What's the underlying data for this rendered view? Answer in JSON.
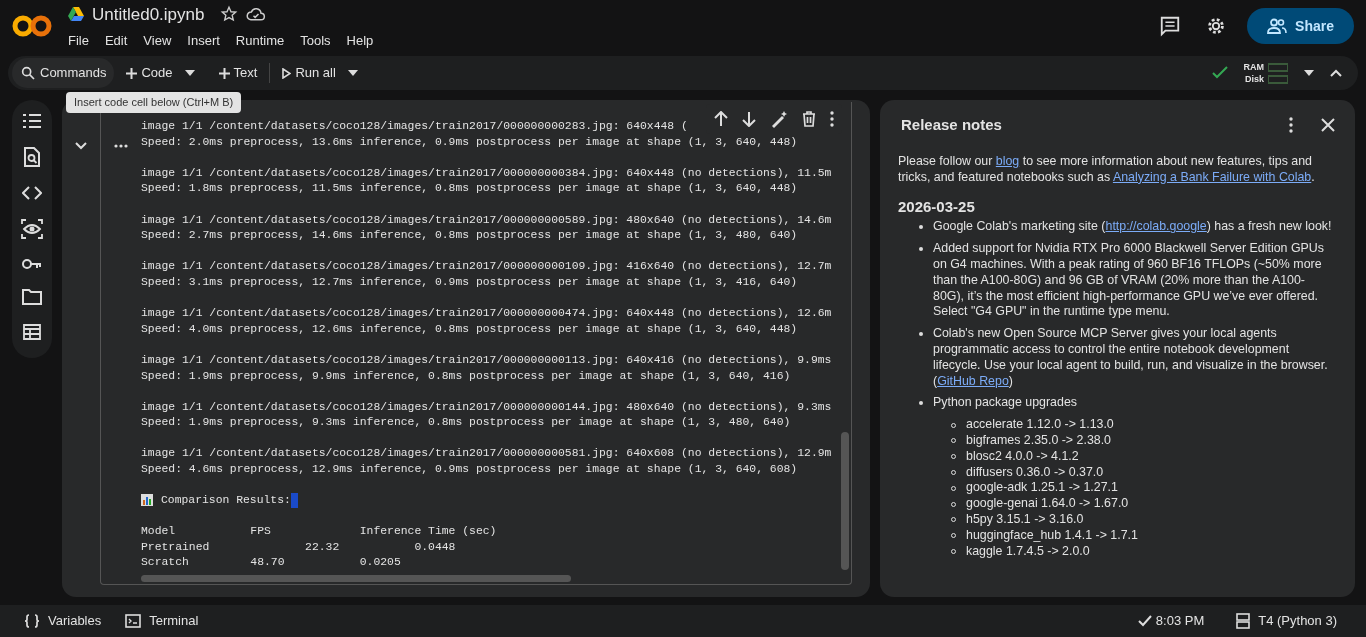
{
  "header": {
    "title": "Untitled0.ipynb",
    "menu": [
      "File",
      "Edit",
      "View",
      "Insert",
      "Runtime",
      "Tools",
      "Help"
    ],
    "share": "Share"
  },
  "toolbar": {
    "commands": "Commands",
    "actions": [
      {
        "kind": "add",
        "label": "Code",
        "dropdown": true
      },
      {
        "kind": "add",
        "label": "Text",
        "dropdown": false
      },
      {
        "kind": "run",
        "label": "Run all",
        "dropdown": true
      }
    ],
    "connected": true,
    "ram": "RAM",
    "disk": "Disk"
  },
  "tooltip": "Insert code cell below (Ctrl+M B)",
  "cell": {
    "expanded": true,
    "output": [
      [
        "image 1/1 /content/datasets/coco128/images/train2017/000000000283.jpg: 640x448 (",
        "Speed: 2.0ms preprocess, 13.6ms inference, 0.9ms postprocess per image at shape (1, 3, 640, 448)"
      ],
      [
        "image 1/1 /content/datasets/coco128/images/train2017/000000000384.jpg: 640x448 (no detections), 11.5m",
        "Speed: 1.8ms preprocess, 11.5ms inference, 0.8ms postprocess per image at shape (1, 3, 640, 448)"
      ],
      [
        "image 1/1 /content/datasets/coco128/images/train2017/000000000589.jpg: 480x640 (no detections), 14.6m",
        "Speed: 2.7ms preprocess, 14.6ms inference, 0.8ms postprocess per image at shape (1, 3, 480, 640)"
      ],
      [
        "image 1/1 /content/datasets/coco128/images/train2017/000000000109.jpg: 416x640 (no detections), 12.7m",
        "Speed: 3.1ms preprocess, 12.7ms inference, 0.9ms postprocess per image at shape (1, 3, 416, 640)"
      ],
      [
        "image 1/1 /content/datasets/coco128/images/train2017/000000000474.jpg: 640x448 (no detections), 12.6m",
        "Speed: 4.0ms preprocess, 12.6ms inference, 0.8ms postprocess per image at shape (1, 3, 640, 448)"
      ],
      [
        "image 1/1 /content/datasets/coco128/images/train2017/000000000113.jpg: 640x416 (no detections), 9.9ms",
        "Speed: 1.9ms preprocess, 9.9ms inference, 0.8ms postprocess per image at shape (1, 3, 640, 416)"
      ],
      [
        "image 1/1 /content/datasets/coco128/images/train2017/000000000144.jpg: 480x640 (no detections), 9.3ms",
        "Speed: 1.9ms preprocess, 9.3ms inference, 0.8ms postprocess per image at shape (1, 3, 480, 640)"
      ],
      [
        "image 1/1 /content/datasets/coco128/images/train2017/000000000581.jpg: 640x608 (no detections), 12.9m",
        "Speed: 4.6ms preprocess, 12.9ms inference, 0.9ms postprocess per image at shape (1, 3, 640, 608)"
      ]
    ],
    "results_title": "Comparison Results:",
    "table": [
      "Model           FPS             Inference Time (sec)",
      "Pretrained              22.32           0.0448",
      "Scratch         48.70           0.0205"
    ]
  },
  "release_notes": {
    "title": "Release notes",
    "intro": [
      {
        "kind": "text",
        "text": "Please follow our "
      },
      {
        "kind": "link",
        "text": "blog"
      },
      {
        "kind": "text",
        "text": " to see more information about new features, tips and tricks, and featured notebooks such as "
      },
      {
        "kind": "link",
        "text": "Analyzing a Bank Failure with Colab"
      },
      {
        "kind": "text",
        "text": "."
      }
    ],
    "date": "2026-03-25",
    "bullets": [
      {
        "parts": [
          {
            "kind": "text",
            "text": "Google Colab's marketing site ("
          },
          {
            "kind": "link",
            "text": "http://colab.google"
          },
          {
            "kind": "text",
            "text": ") has a fresh new look!"
          }
        ]
      },
      {
        "parts": [
          {
            "kind": "text",
            "text": "Added support for Nvidia RTX Pro 6000 Blackwell Server Edition GPUs on G4 machines. With a peak rating of 960 BF16 TFLOPs (~50% more than the A100-80G) and 96 GB of VRAM (20% more than the A100-80G), it’s the most efficient high-performance GPU we’ve ever offered. Select \"G4 GPU\" in the runtime type menu."
          }
        ]
      },
      {
        "parts": [
          {
            "kind": "text",
            "text": "Colab's new Open Source MCP Server gives your local agents programmatic access to control the entire notebook development lifecycle. Use your local agent to build, run, and visualize in the browser. ("
          },
          {
            "kind": "link",
            "text": "GitHub Repo"
          },
          {
            "kind": "text",
            "text": ")"
          }
        ]
      },
      {
        "parts": [
          {
            "kind": "text",
            "text": "Python package upgrades"
          }
        ],
        "children": [
          "accelerate 1.12.0 -> 1.13.0",
          "bigframes 2.35.0 -> 2.38.0",
          "blosc2 4.0.0 -> 4.1.2",
          "diffusers 0.36.0 -> 0.37.0",
          "google-adk 1.25.1 -> 1.27.1",
          "google-genai 1.64.0 -> 1.67.0",
          "h5py 3.15.1 -> 3.16.0",
          "huggingface_hub 1.4.1 -> 1.7.1",
          "kaggle 1.7.4.5 -> 2.0.0"
        ]
      }
    ]
  },
  "status_bar": {
    "variables": "Variables",
    "terminal": "Terminal",
    "saved": true,
    "time": "8:03 PM",
    "runtime": "T4 (Python 3)"
  }
}
